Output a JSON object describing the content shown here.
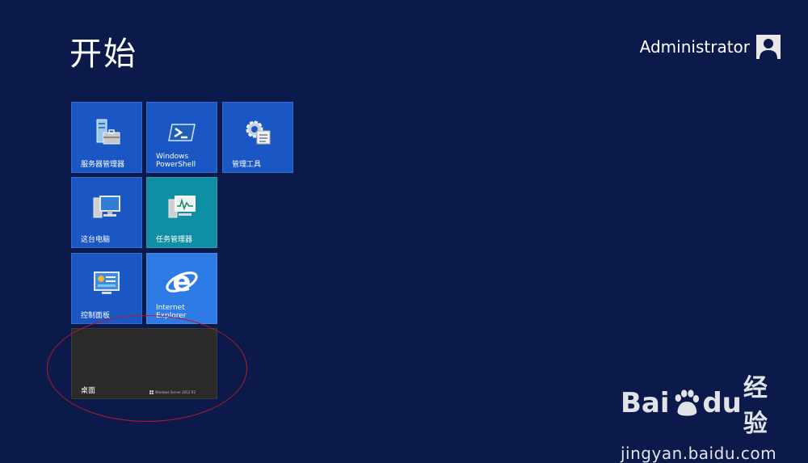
{
  "start": {
    "title": "开始"
  },
  "user": {
    "name": "Administrator"
  },
  "tiles": [
    {
      "label": "服务器管理器",
      "icon": "server-manager-icon"
    },
    {
      "label": "Windows\nPowerShell",
      "icon": "powershell-icon"
    },
    {
      "label": "管理工具",
      "icon": "admin-tools-icon"
    },
    {
      "label": "这台电脑",
      "icon": "this-pc-icon"
    },
    {
      "label": "任务管理器",
      "icon": "task-manager-icon"
    },
    {
      "label": "控制面板",
      "icon": "control-panel-icon"
    },
    {
      "label": "Internet\nExplorer",
      "icon": "ie-icon"
    }
  ],
  "desktop_tile": {
    "label": "桌面",
    "badge": "Windows Server 2012 R2"
  },
  "watermark": {
    "brand_left": "Bai",
    "brand_right": "du",
    "brand_cn": "经验",
    "url": "jingyan.baidu.com"
  },
  "colors": {
    "background": "#0b1a4a",
    "tile_blue": "#1a57c4",
    "tile_teal": "#0f8fa3",
    "tile_ie": "#2e7be6",
    "annotation": "#b11a2a"
  }
}
